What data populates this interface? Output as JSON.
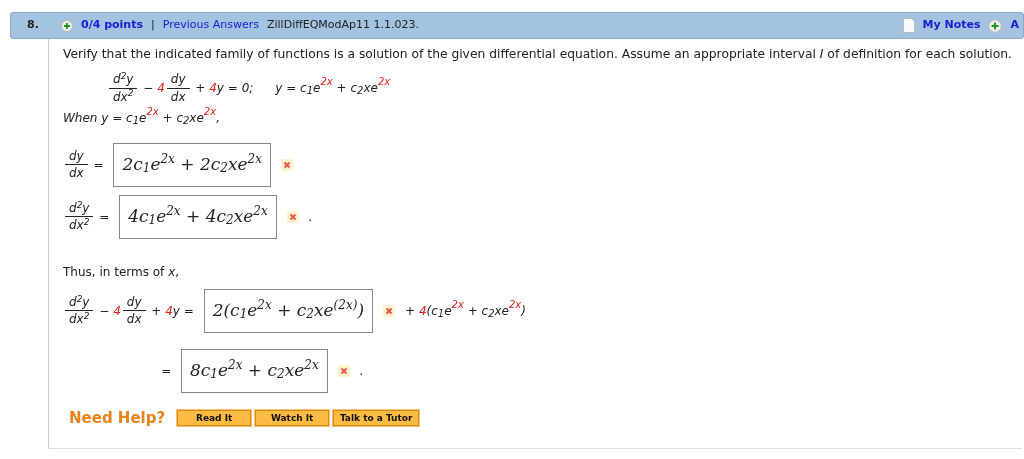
{
  "header": {
    "number": "8.",
    "points": "0/4 points",
    "separator": "|",
    "previous_answers": "Previous Answers",
    "source": "ZillDiffEQModAp11 1.1.023.",
    "my_notes": "My Notes",
    "cut_label": "A"
  },
  "prompt": "Verify that the indicated family of functions is a solution of the given differential equation. Assume an appropriate interval *I* of definition for each solution.",
  "equation": {
    "ode": [
      {
        "kind": "frac",
        "num": "d$^{2}$y",
        "den": "dx$^{2}$",
        "highlight": false
      },
      {
        "kind": "text",
        "text": " − ",
        "highlight": false
      },
      {
        "kind": "text",
        "text": "4",
        "highlight": true
      },
      {
        "kind": "frac",
        "num": "dy",
        "den": "dx",
        "highlight": false
      },
      {
        "kind": "text",
        "text": " + ",
        "highlight": false
      },
      {
        "kind": "text",
        "text": "4",
        "highlight": true
      },
      {
        "kind": "text",
        "text": "y = 0;",
        "highlight": false
      }
    ],
    "solution": [
      {
        "kind": "text",
        "text": "y = c",
        "highlight": false
      },
      {
        "kind": "sub",
        "text": "1",
        "highlight": false
      },
      {
        "kind": "text",
        "text": "e",
        "highlight": false
      },
      {
        "kind": "sup",
        "text": "2x",
        "highlight": true
      },
      {
        "kind": "text",
        "text": " + c",
        "highlight": false
      },
      {
        "kind": "sub",
        "text": "2",
        "highlight": false
      },
      {
        "kind": "text",
        "text": "xe",
        "highlight": false
      },
      {
        "kind": "sup",
        "text": "2x",
        "highlight": true
      }
    ]
  },
  "when": [
    {
      "kind": "text",
      "text": "When y = c",
      "highlight": false
    },
    {
      "kind": "sub",
      "text": "1",
      "highlight": false
    },
    {
      "kind": "text",
      "text": "e",
      "highlight": false
    },
    {
      "kind": "sup",
      "text": "2x",
      "highlight": true
    },
    {
      "kind": "text",
      "text": " + c",
      "highlight": false
    },
    {
      "kind": "sub",
      "text": "2",
      "highlight": false
    },
    {
      "kind": "text",
      "text": "xe",
      "highlight": false
    },
    {
      "kind": "sup",
      "text": "2x",
      "highlight": true
    },
    {
      "kind": "text",
      "text": ",",
      "highlight": false
    }
  ],
  "derivatives": [
    {
      "lhs": [
        {
          "kind": "frac",
          "num": "dy",
          "den": "dx",
          "highlight": false
        },
        {
          "kind": "text",
          "text": " = ",
          "highlight": false
        }
      ],
      "answer": "2c$_{1}$e$^{2x}$ + 2c$_{2}$xe$^{2x}$",
      "correct": false
    },
    {
      "lhs": [
        {
          "kind": "frac",
          "num": "d$^{2}$y",
          "den": "dx$^{2}$",
          "highlight": false
        },
        {
          "kind": "text",
          "text": " = ",
          "highlight": false
        }
      ],
      "answer": "4c$_{1}$e$^{2x}$ + 4c$_{2}$xe$^{2x}$",
      "correct": false,
      "after": [
        {
          "kind": "text",
          "text": ".",
          "highlight": false
        }
      ]
    }
  ],
  "thus": "Thus, in terms of *x*,",
  "substitution": [
    {
      "lhs": [
        {
          "kind": "frac",
          "num": "d$^{2}$y",
          "den": "dx$^{2}$",
          "highlight": false
        },
        {
          "kind": "text",
          "text": " − ",
          "highlight": false
        },
        {
          "kind": "text",
          "text": "4",
          "highlight": true
        },
        {
          "kind": "frac",
          "num": "dy",
          "den": "dx",
          "highlight": false
        },
        {
          "kind": "text",
          "text": " + ",
          "highlight": false
        },
        {
          "kind": "text",
          "text": "4",
          "highlight": true
        },
        {
          "kind": "text",
          "text": "y = ",
          "highlight": false
        }
      ],
      "answer": "2(c$_{1}$e$^{2x}$ + c$_{2}$xe$^{(2x)}$)",
      "correct": false,
      "after": [
        {
          "kind": "text",
          "text": "+ ",
          "highlight": false
        },
        {
          "kind": "text",
          "text": "4",
          "highlight": true
        },
        {
          "kind": "text",
          "text": "(c",
          "highlight": false
        },
        {
          "kind": "sub",
          "text": "1",
          "highlight": false
        },
        {
          "kind": "text",
          "text": "e",
          "highlight": false
        },
        {
          "kind": "sup",
          "text": "2x",
          "highlight": true
        },
        {
          "kind": "text",
          "text": " + c",
          "highlight": false
        },
        {
          "kind": "sub",
          "text": "2",
          "highlight": false
        },
        {
          "kind": "text",
          "text": "xe",
          "highlight": false
        },
        {
          "kind": "sup",
          "text": "2x",
          "highlight": true
        },
        {
          "kind": "text",
          "text": ")",
          "highlight": false
        }
      ]
    },
    {
      "lhs": [
        {
          "kind": "text",
          "text": " = ",
          "highlight": false
        }
      ],
      "answer": "8c$_{1}$e$^{2x}$ + c$_{2}$xe$^{2x}$",
      "correct": false,
      "after": [
        {
          "kind": "text",
          "text": ".",
          "highlight": false
        }
      ]
    }
  ],
  "help": {
    "label": "Need Help?",
    "buttons": [
      "Read It",
      "Watch It",
      "Talk to a Tutor"
    ]
  }
}
